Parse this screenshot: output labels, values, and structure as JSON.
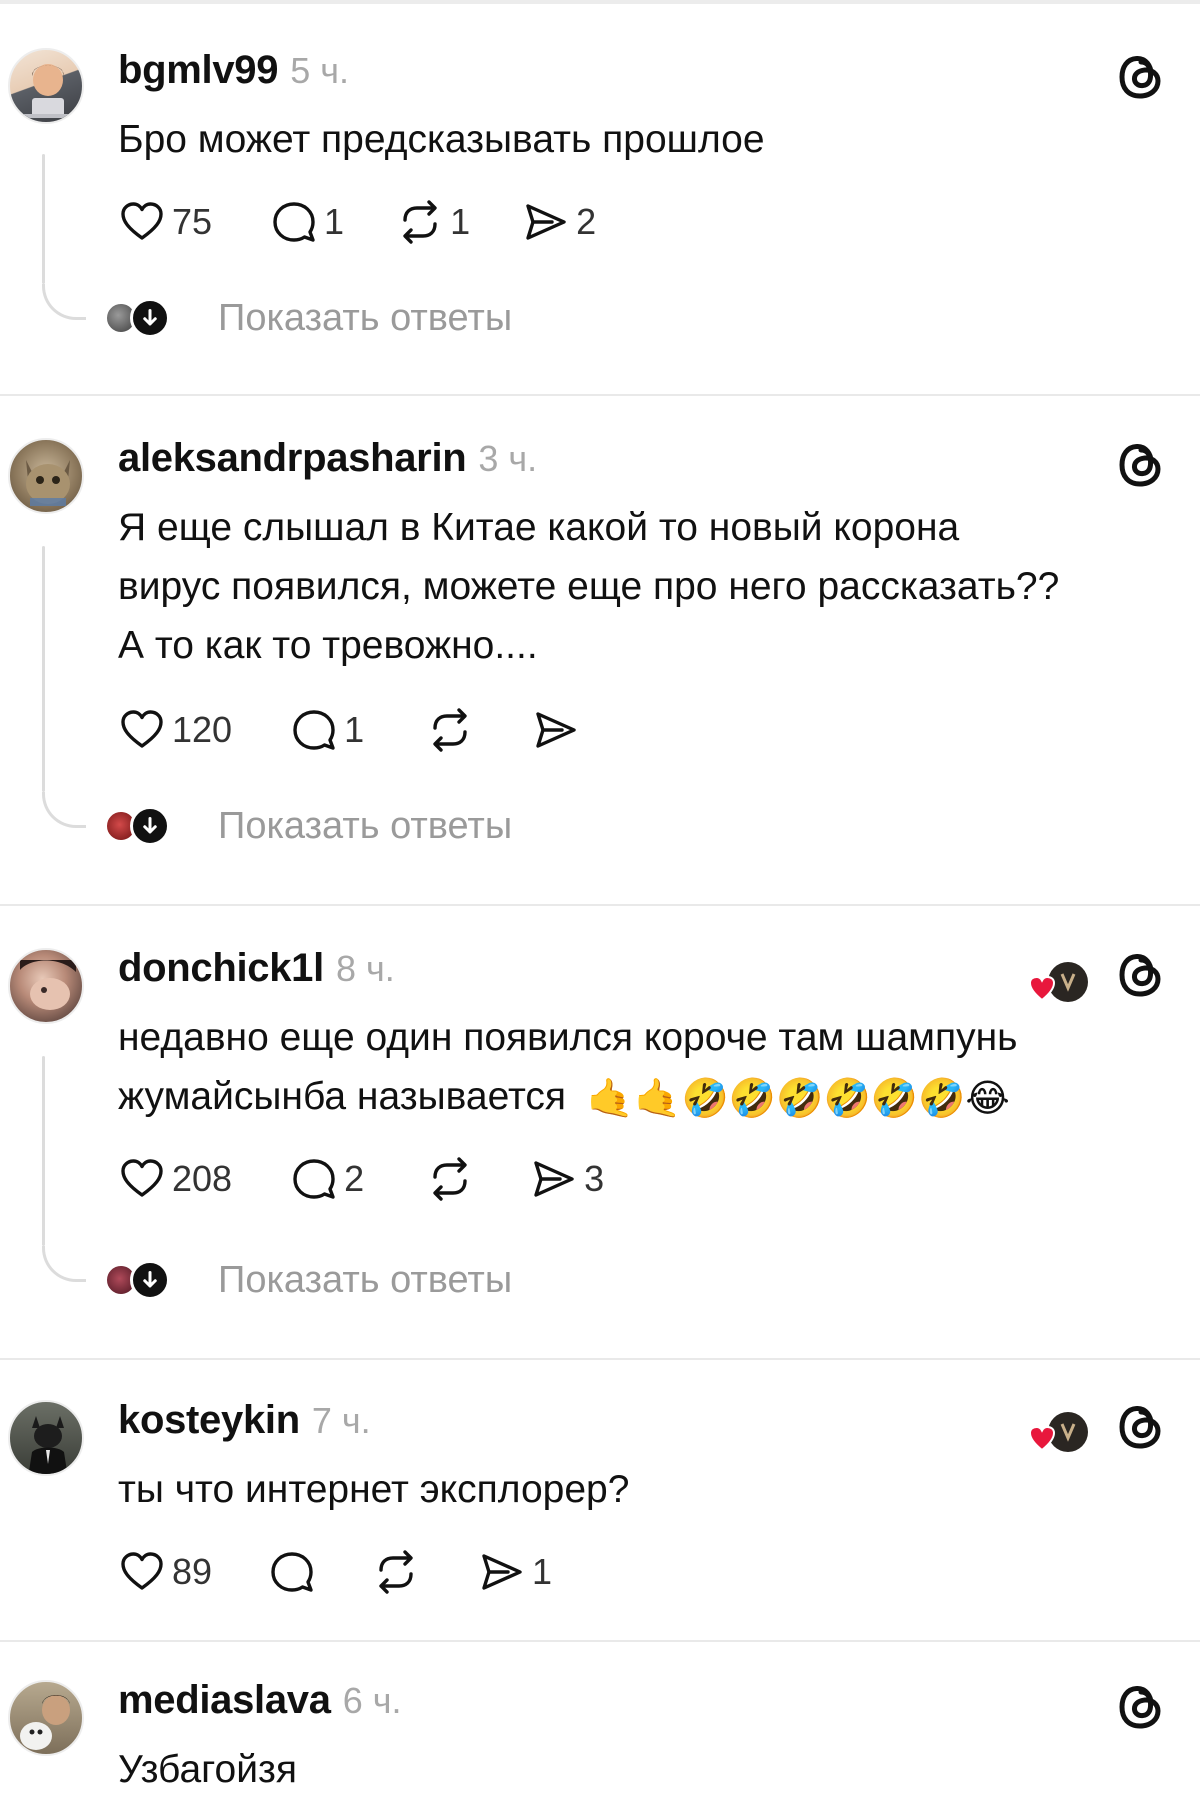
{
  "posts": [
    {
      "username": "bgmlv99",
      "time": "5 ч.",
      "text": "Бро может предсказывать прошлое",
      "likes": "75",
      "comments": "1",
      "reposts": "1",
      "shares": "2",
      "show_replies": "Показать ответы"
    },
    {
      "username": "aleksandrpasharin",
      "time": "3 ч.",
      "text_lines": [
        "Я еще слышал в Китае какой то новый корона",
        "вирус появился, можете еще про него рассказать??",
        "А то как то тревожно...."
      ],
      "likes": "120",
      "comments": "1",
      "show_replies": "Показать ответы"
    },
    {
      "username": "donchick1l",
      "time": "8 ч.",
      "text_lines": [
        "недавно еще один появился короче там шампунь",
        "жумайсынба называется"
      ],
      "emoji": "🤙🤙🤣🤣🤣🤣🤣🤣😂",
      "likes": "208",
      "comments": "2",
      "shares": "3",
      "show_replies": "Показать ответы"
    },
    {
      "username": "kosteykin",
      "time": "7 ч.",
      "text": "ты что интернет эксплорер?",
      "likes": "89",
      "shares": "1"
    },
    {
      "username": "mediaslava",
      "time": "6 ч.",
      "text": "Узбагойзя"
    }
  ],
  "icons": {
    "like": "heart-icon",
    "comment": "comment-bubble-icon",
    "repost": "repost-icon",
    "share": "send-icon",
    "threads": "threads-logo-icon",
    "expand": "arrow-down-icon"
  },
  "colors": {
    "text": "#111111",
    "muted": "#a8a8a8",
    "divider": "#e9e9e9",
    "liked_heart": "#e8173c"
  }
}
